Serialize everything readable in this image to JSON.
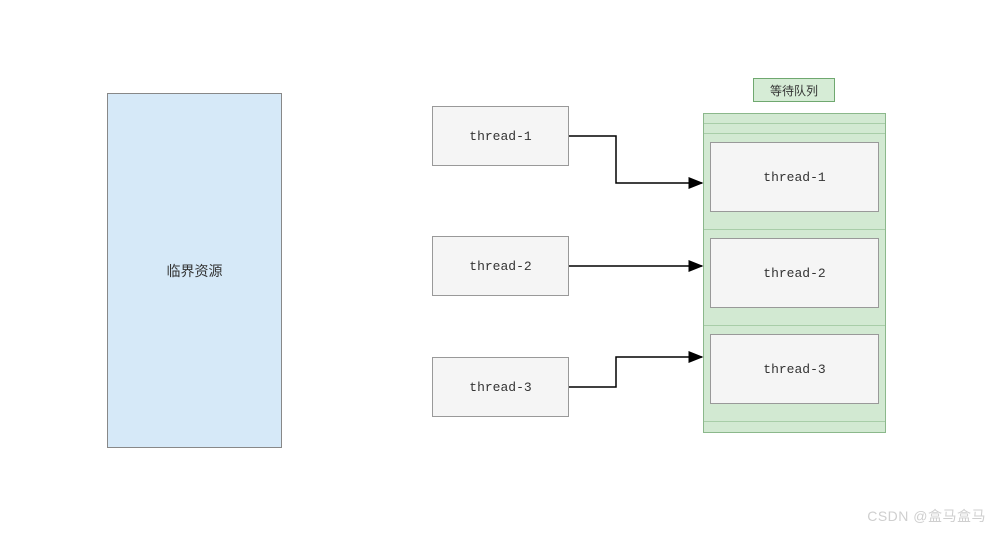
{
  "critical_resource": {
    "label": "临界资源"
  },
  "threads": {
    "t1": "thread-1",
    "t2": "thread-2",
    "t3": "thread-3"
  },
  "queue": {
    "header": "等待队列",
    "items": {
      "q1": "thread-1",
      "q2": "thread-2",
      "q3": "thread-3"
    }
  },
  "watermark": "CSDN @盒马盒马"
}
